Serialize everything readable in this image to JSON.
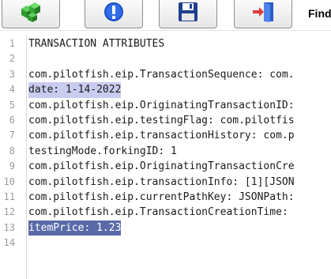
{
  "toolbar": {
    "find_label": "Find",
    "buttons": [
      {
        "icon": "green-cubes-icon"
      },
      {
        "icon": "info-icon"
      },
      {
        "icon": "save-disk-icon"
      },
      {
        "icon": "exit-door-icon"
      }
    ]
  },
  "editor": {
    "lines": [
      {
        "num": "1",
        "text": "TRANSACTION ATTRIBUTES",
        "highlight": "none"
      },
      {
        "num": "2",
        "text": "",
        "highlight": "none"
      },
      {
        "num": "3",
        "text": "com.pilotfish.eip.TransactionSequence: com.",
        "highlight": "none"
      },
      {
        "num": "4",
        "text": "date: 1-14-2022",
        "highlight": "light"
      },
      {
        "num": "5",
        "text": "com.pilotfish.eip.OriginatingTransactionID:",
        "highlight": "none"
      },
      {
        "num": "6",
        "text": "com.pilotfish.eip.testingFlag: com.pilotfis",
        "highlight": "none"
      },
      {
        "num": "7",
        "text": "com.pilotfish.eip.transactionHistory: com.p",
        "highlight": "none"
      },
      {
        "num": "8",
        "text": "testingMode.forkingID: 1",
        "highlight": "none"
      },
      {
        "num": "9",
        "text": "com.pilotfish.eip.OriginatingTransactionCre",
        "highlight": "none"
      },
      {
        "num": "10",
        "text": "com.pilotfish.eip.transactionInfo: [1][JSON",
        "highlight": "none"
      },
      {
        "num": "11",
        "text": "com.pilotfish.eip.currentPathKey: JSONPath:",
        "highlight": "none"
      },
      {
        "num": "12",
        "text": "com.pilotfish.eip.TransactionCreationTime: ",
        "highlight": "none"
      },
      {
        "num": "13",
        "text": "itemPrice: 1.23",
        "highlight": "dark"
      },
      {
        "num": "14",
        "text": "",
        "highlight": "none"
      }
    ]
  },
  "colors": {
    "highlight_light": "#c9ccef",
    "highlight_dark": "#5a6aa8",
    "line_number": "#9a9a9a"
  }
}
